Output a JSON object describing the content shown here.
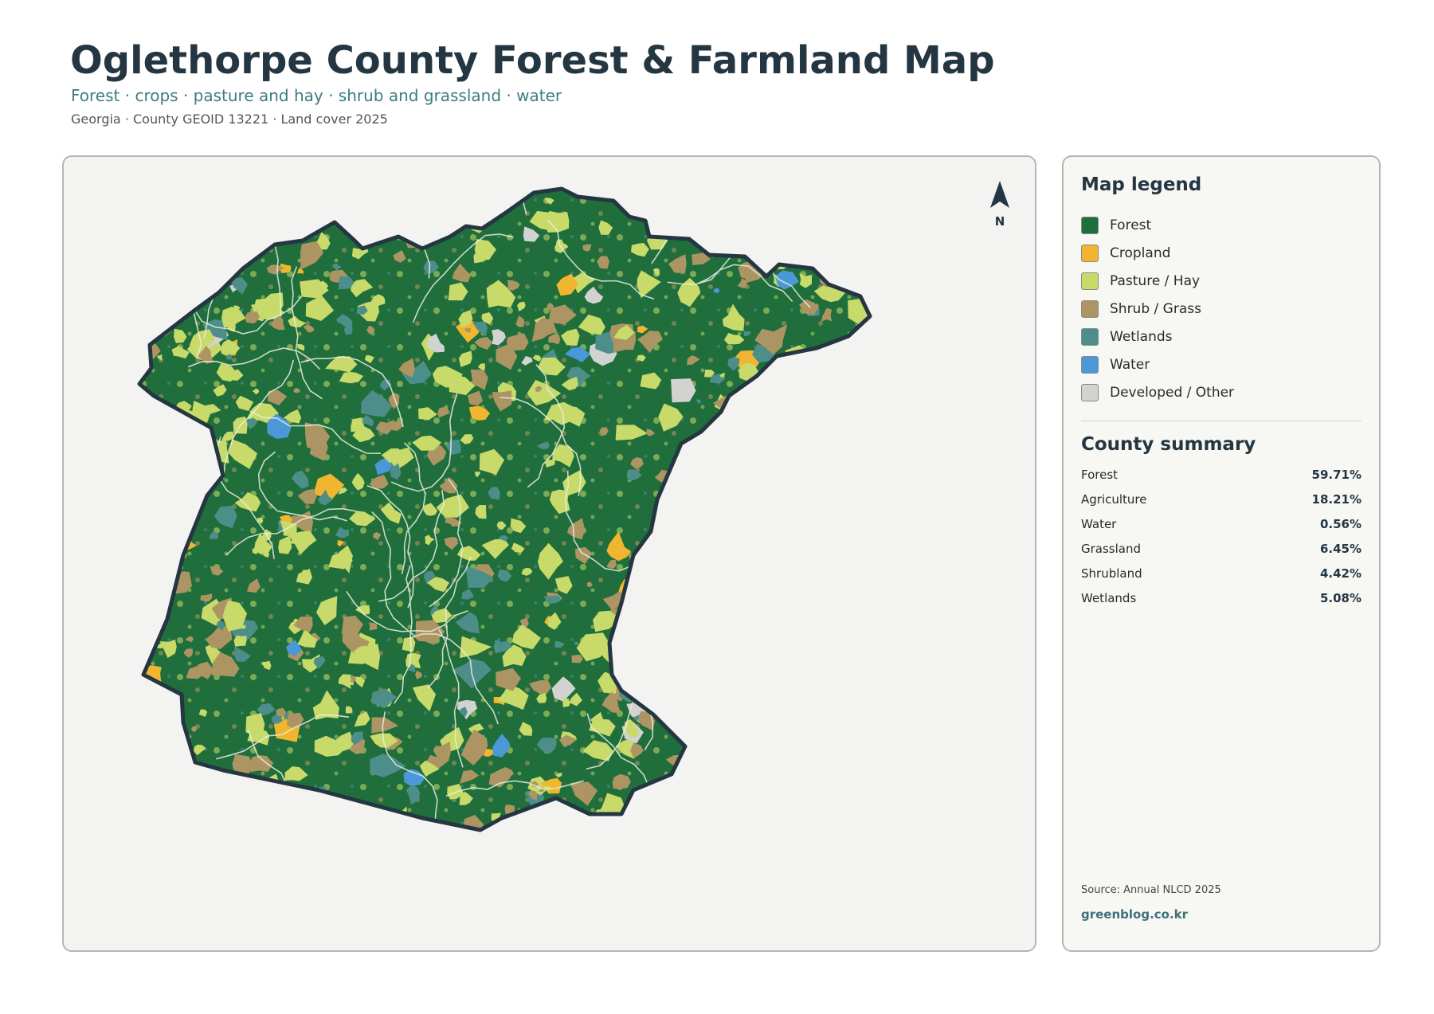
{
  "header": {
    "title": "Oglethorpe County Forest & Farmland Map",
    "subtitle": "Forest · crops · pasture and hay · shrub and grassland · water",
    "meta": "Georgia · County GEOID 13221 · Land cover 2025"
  },
  "map": {
    "north_label": "N"
  },
  "legend": {
    "title": "Map legend",
    "items": [
      {
        "label": "Forest",
        "color": "#1f6e3c"
      },
      {
        "label": "Cropland",
        "color": "#f0b630"
      },
      {
        "label": "Pasture / Hay",
        "color": "#c8da6a"
      },
      {
        "label": "Shrub / Grass",
        "color": "#ad9563"
      },
      {
        "label": "Wetlands",
        "color": "#4d8e8a"
      },
      {
        "label": "Water",
        "color": "#4a98d8"
      },
      {
        "label": "Developed / Other",
        "color": "#d2d2d0"
      }
    ]
  },
  "summary": {
    "title": "County summary",
    "rows": [
      {
        "label": "Forest",
        "value": "59.71%"
      },
      {
        "label": "Agriculture",
        "value": "18.21%"
      },
      {
        "label": "Water",
        "value": "0.56%"
      },
      {
        "label": "Grassland",
        "value": "6.45%"
      },
      {
        "label": "Shrubland",
        "value": "4.42%"
      },
      {
        "label": "Wetlands",
        "value": "5.08%"
      }
    ]
  },
  "footer": {
    "source": "Source: Annual NLCD 2025",
    "credit": "greenblog.co.kr"
  }
}
